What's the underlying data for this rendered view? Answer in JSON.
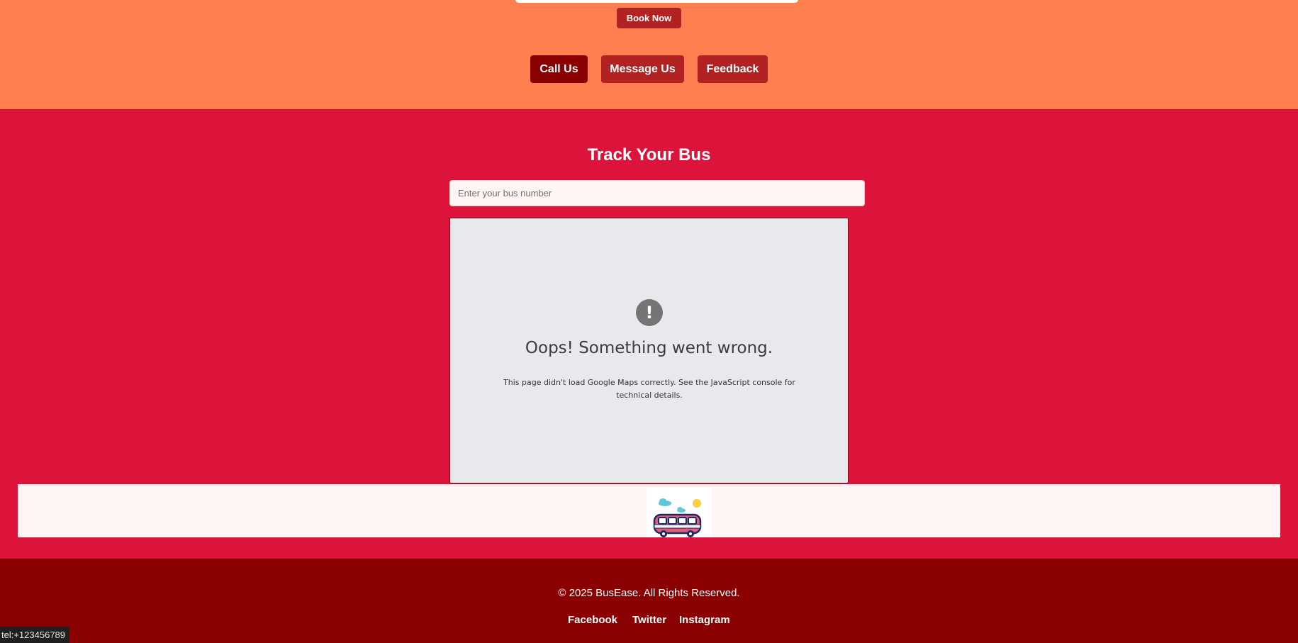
{
  "header": {
    "book_now_label": "Book Now",
    "contact_buttons": {
      "call": "Call Us",
      "message": "Message Us",
      "feedback": "Feedback"
    }
  },
  "tracker": {
    "title": "Track Your Bus",
    "input_placeholder": "Enter your bus number",
    "map_error": {
      "icon": "!",
      "title": "Oops! Something went wrong.",
      "description": "This page didn't load Google Maps correctly. See the JavaScript console for technical details."
    }
  },
  "footer": {
    "copyright": "© 2025 BusEase. All Rights Reserved.",
    "links": {
      "facebook": "Facebook",
      "twitter": "Twitter",
      "instagram": "Instagram"
    }
  },
  "status_bar": {
    "url": "tel:+123456789"
  },
  "colors": {
    "top_background": "#ff7f50",
    "section_background": "#dc143c",
    "footer_background": "#8b0000",
    "button_primary": "#b22222",
    "button_active": "#8b0000"
  },
  "icons": {
    "error": "error-exclamation-icon",
    "bus": "bus-illustration"
  }
}
